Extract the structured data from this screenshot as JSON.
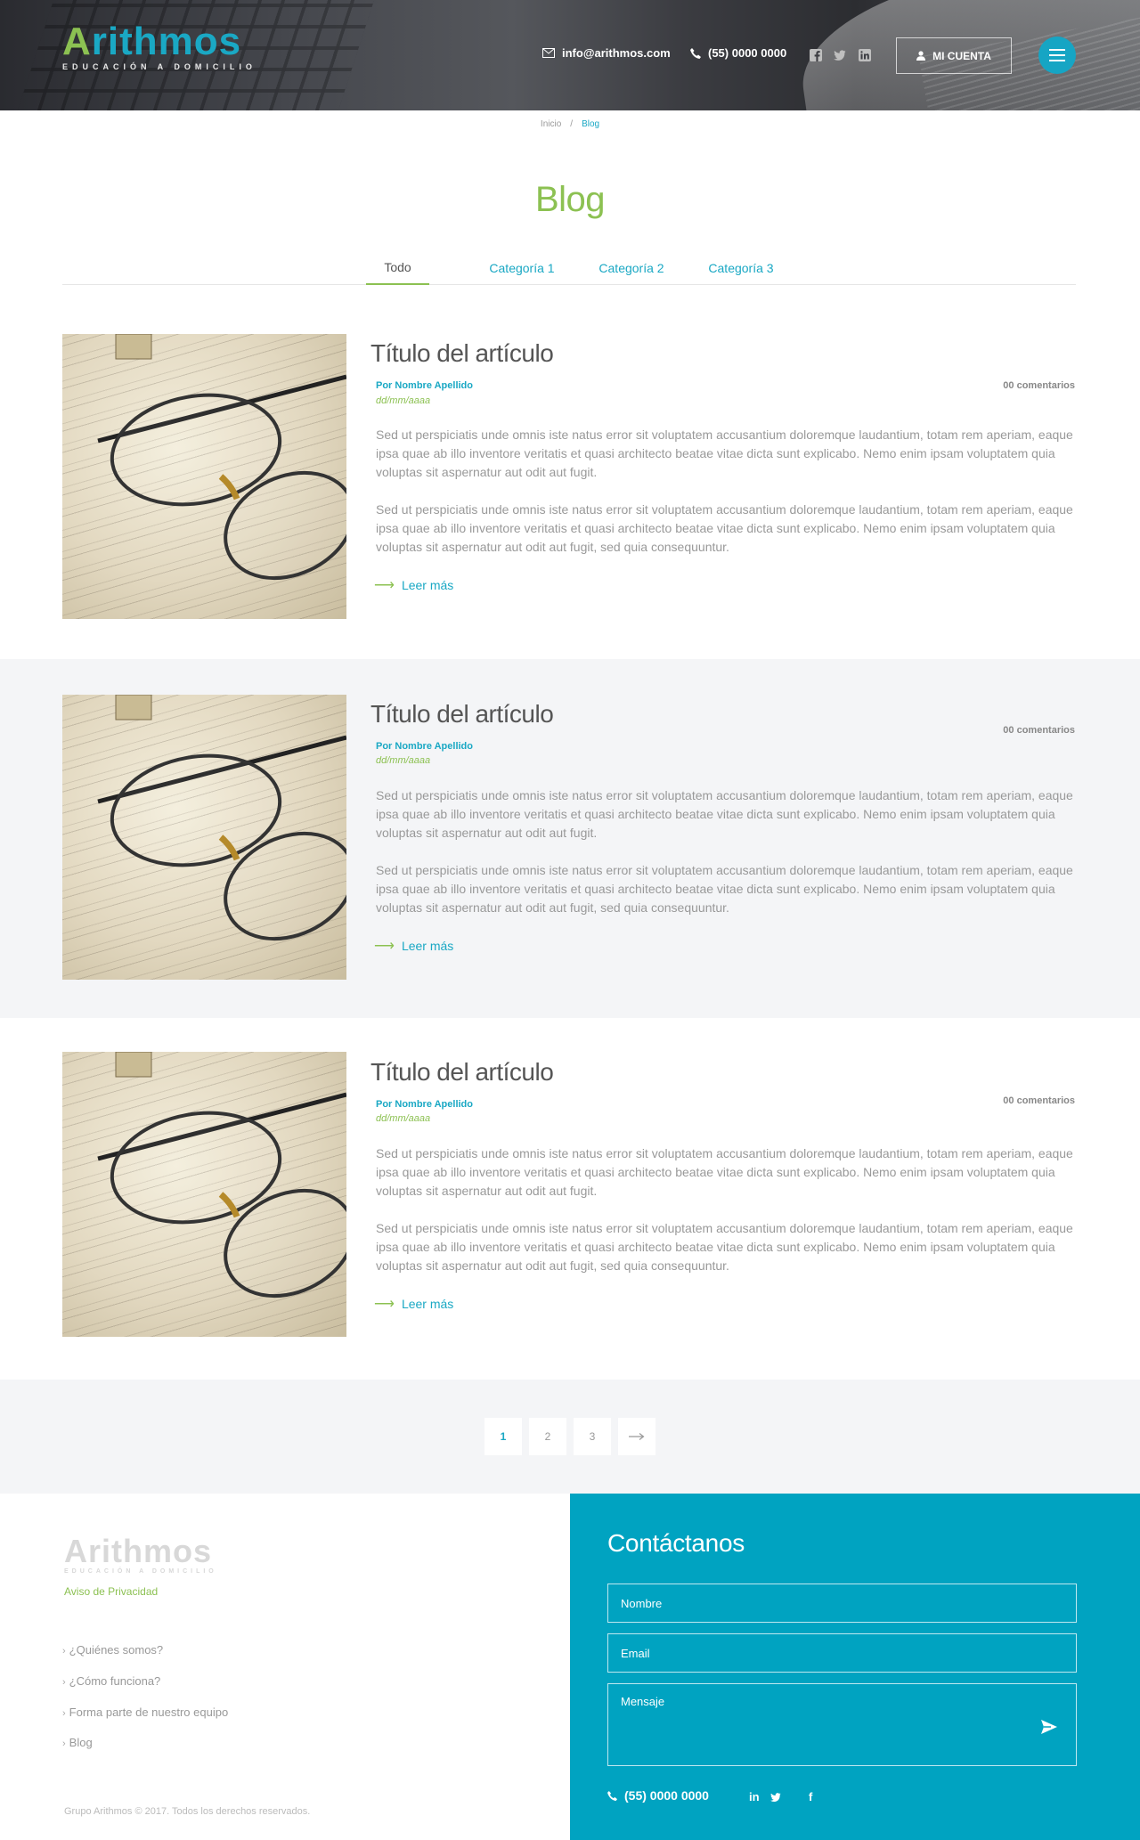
{
  "header": {
    "logo_text": "Arithmos",
    "logo_sub": "EDUCACIÓN A DOMICILIO",
    "email": "info@arithmos.com",
    "phone": "(55) 0000 0000",
    "social_icons": [
      "facebook-icon",
      "twitter-icon",
      "linkedin-icon"
    ],
    "account_label": "MI CUENTA"
  },
  "breadcrumb": {
    "home": "Inicio",
    "separator": "/",
    "current": "Blog"
  },
  "page_title": "Blog",
  "tabs": [
    "Todo",
    "Categoría 1",
    "Categoría 2",
    "Categoría 3"
  ],
  "active_tab": "Todo",
  "articles": [
    {
      "title": "Título del artículo",
      "author": "Por Nombre Apellido",
      "date": "dd/mm/aaaa",
      "comments": "00 comentarios",
      "p1": "Sed ut perspiciatis unde omnis iste natus error sit voluptatem accusantium doloremque laudantium, totam rem aperiam, eaque ipsa quae ab illo inventore veritatis et quasi architecto beatae vitae dicta sunt explicabo. Nemo enim ipsam voluptatem quia voluptas sit aspernatur aut odit aut fugit.",
      "p2": "Sed ut perspiciatis unde omnis iste natus error sit voluptatem accusantium doloremque laudantium, totam rem aperiam, eaque ipsa quae ab illo inventore veritatis et quasi architecto beatae vitae dicta sunt explicabo. Nemo enim ipsam voluptatem quia voluptas sit aspernatur aut odit aut fugit, sed quia consequuntur.",
      "read_more": "Leer más"
    },
    {
      "title": "Título del artículo",
      "author": "Por Nombre Apellido",
      "date": "dd/mm/aaaa",
      "comments": "00 comentarios",
      "p1": "Sed ut perspiciatis unde omnis iste natus error sit voluptatem accusantium doloremque laudantium, totam rem aperiam, eaque ipsa quae ab illo inventore veritatis et quasi architecto beatae vitae dicta sunt explicabo. Nemo enim ipsam voluptatem quia voluptas sit aspernatur aut odit aut fugit.",
      "p2": "Sed ut perspiciatis unde omnis iste natus error sit voluptatem accusantium doloremque laudantium, totam rem aperiam, eaque ipsa quae ab illo inventore veritatis et quasi architecto beatae vitae dicta sunt explicabo. Nemo enim ipsam voluptatem quia voluptas sit aspernatur aut odit aut fugit, sed quia consequuntur.",
      "read_more": "Leer más"
    },
    {
      "title": "Título del artículo",
      "author": "Por Nombre Apellido",
      "date": "dd/mm/aaaa",
      "comments": "00 comentarios",
      "p1": "Sed ut perspiciatis unde omnis iste natus error sit voluptatem accusantium doloremque laudantium, totam rem aperiam, eaque ipsa quae ab illo inventore veritatis et quasi architecto beatae vitae dicta sunt explicabo. Nemo enim ipsam voluptatem quia voluptas sit aspernatur aut odit aut fugit.",
      "p2": "Sed ut perspiciatis unde omnis iste natus error sit voluptatem accusantium doloremque laudantium, totam rem aperiam, eaque ipsa quae ab illo inventore veritatis et quasi architecto beatae vitae dicta sunt explicabo. Nemo enim ipsam voluptatem quia voluptas sit aspernatur aut odit aut fugit, sed quia consequuntur.",
      "read_more": "Leer más"
    }
  ],
  "pagination": {
    "pages": [
      "1",
      "2",
      "3"
    ],
    "current": "1",
    "next_icon": "arrow-right-icon"
  },
  "footer": {
    "logo_text": "Arithmos",
    "logo_sub": "EDUCACIÓN A DOMICILIO",
    "privacy": "Aviso de Privacidad",
    "links": [
      "¿Quiénes somos?",
      "¿Cómo funciona?",
      "Forma parte de nuestro equipo",
      "Blog"
    ],
    "copyright": "Grupo Arithmos © 2017. Todos los derechos reservados."
  },
  "contact": {
    "title": "Contáctanos",
    "name_placeholder": "Nombre",
    "email_placeholder": "Email",
    "message_placeholder": "Mensaje",
    "phone": "(55) 0000 0000",
    "social": [
      "in",
      "twitter-icon",
      "f"
    ]
  },
  "colors": {
    "teal": "#00a3c1",
    "green": "#8cc152",
    "gray_bg": "#f4f5f7"
  }
}
